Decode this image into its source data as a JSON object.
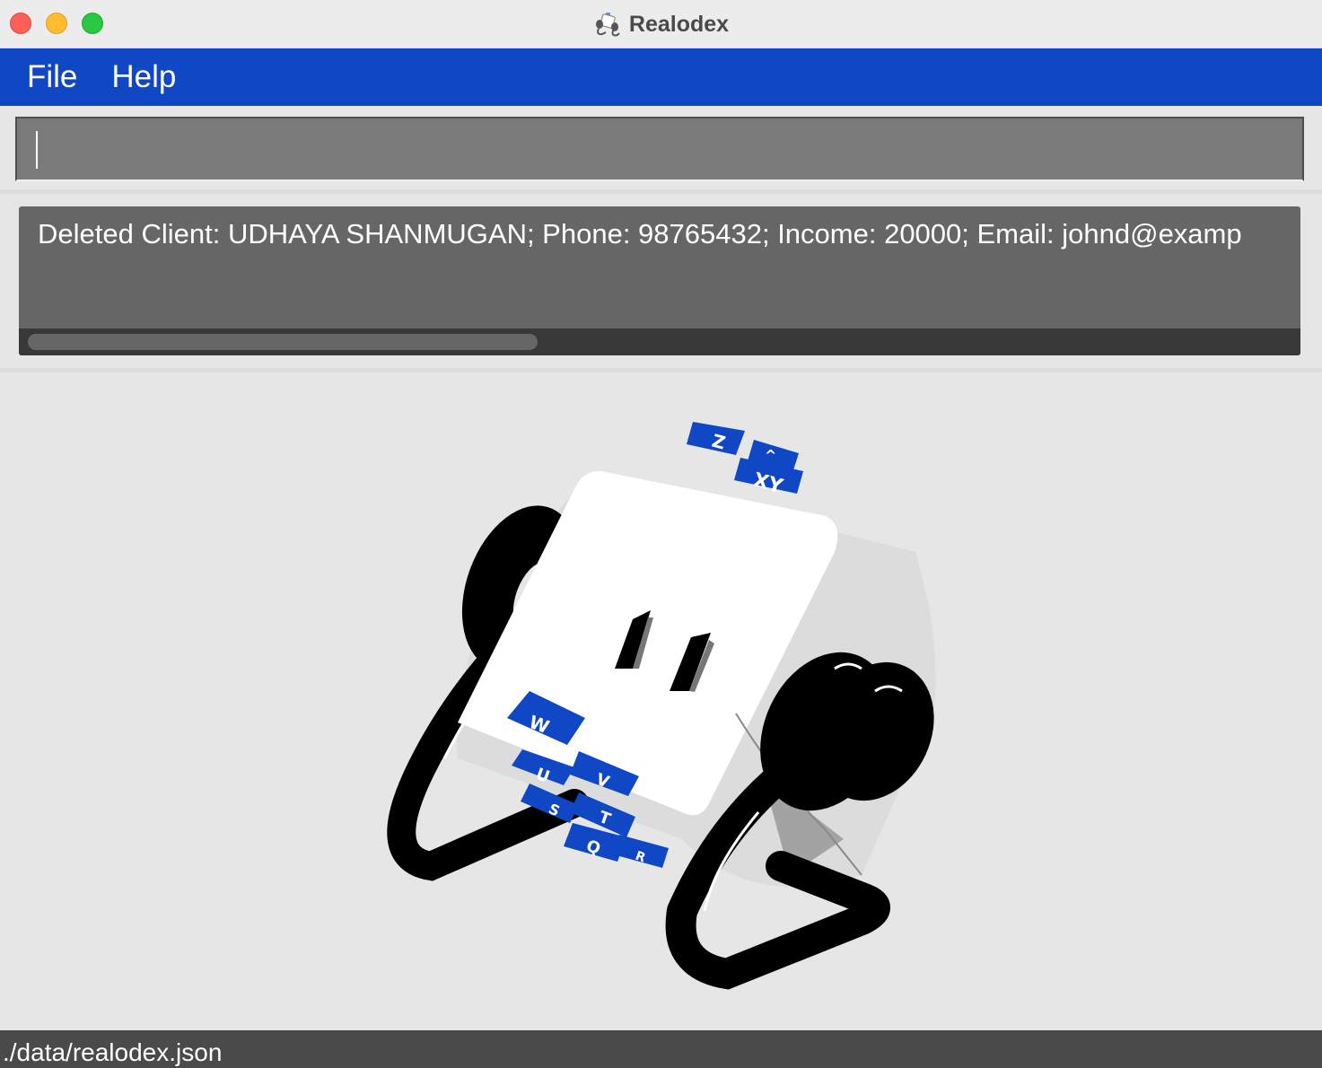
{
  "window": {
    "title": "Realodex",
    "buttons": [
      "close",
      "minimize",
      "maximize"
    ],
    "icon": "rolodex-icon"
  },
  "menubar": {
    "items": [
      {
        "label": "File"
      },
      {
        "label": "Help"
      }
    ]
  },
  "command_box": {
    "value": "",
    "placeholder": ""
  },
  "result_display": {
    "text": "Deleted Client: UDHAYA SHANMUGAN; Phone: 98765432; Income: 20000; Email: johnd@examp"
  },
  "logo": {
    "icon": "rolodex-icon",
    "tabs": [
      "Z",
      "^",
      "XY",
      "W",
      "U",
      "V",
      "S",
      "T",
      "Q",
      "R"
    ]
  },
  "status_bar": {
    "path": "./data/realodex.json"
  },
  "colors": {
    "accent": "#0f47c4",
    "menubar": "#0f47c4",
    "command_bg": "#7a7a7a",
    "result_bg": "#666666",
    "status_bg": "#4a4a4a",
    "window_bg": "#e6e6e6"
  }
}
